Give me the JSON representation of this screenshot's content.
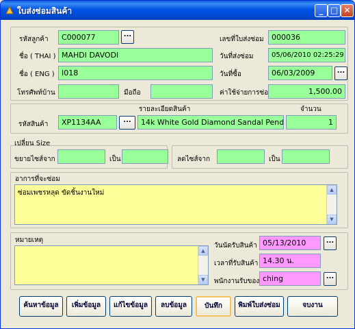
{
  "window": {
    "title": "ใบส่งซ่อมสินค้า"
  },
  "customer": {
    "code_label": "รหัสลูกค้า",
    "code_value": "C000077",
    "name_th_label": "ชื่อ ( THAI )",
    "name_th_value": "MAHDI DAVODI",
    "name_en_label": "ชื่อ ( ENG )",
    "name_en_value": "I018",
    "home_phone_label": "โทรศัพท์บ้าน",
    "home_phone_value": "",
    "mobile_label": "มือถือ",
    "mobile_value": ""
  },
  "repair": {
    "doc_no_label": "เลขที่ใบส่งซ่อม",
    "doc_no_value": "000036",
    "send_date_label": "วันที่ส่งซ่อม",
    "send_date_value": "05/06/2010 02:25:29",
    "purchase_date_label": "วันที่ซื้อ",
    "purchase_date_value": "06/03/2009",
    "cost_label": "ค่าใช้จ่ายการซ่อม",
    "cost_value": "1,500.00"
  },
  "product": {
    "detail_header": "รายละเอียดสินค้า",
    "qty_header": "จำนวน",
    "code_label": "รหัสสินค้า",
    "code_value": "XP1134AA",
    "detail_value": "14k White Gold Diamond Sandal Pendar",
    "qty_value": "1"
  },
  "size": {
    "title": "เปลี่ยน Size",
    "expand_from_label": "ขยายไซส์จาก",
    "expand_from_value": "",
    "to_label_1": "เป็น",
    "expand_to_value": "",
    "reduce_from_label": "ลดไซส์จาก",
    "reduce_from_value": "",
    "to_label_2": "เป็น",
    "reduce_to_value": ""
  },
  "symptom": {
    "label": "อาการที่จะซ่อม",
    "value": "ซ่อมเพชรหลุด ขัดชิ้นงานใหม่"
  },
  "note": {
    "label": "หมายเหตุ",
    "value": ""
  },
  "pickup": {
    "date_label": "วันนัดรับสินค้า",
    "date_value": "05/13/2010",
    "time_label": "เวลาที่รับสินค้า",
    "time_value": "14.30 น.",
    "staff_label": "พนักงานรับของ",
    "staff_value": "ching"
  },
  "ellipsis": "...",
  "buttons": {
    "search": "ค้นหาข้อมูล",
    "add": "เพิ่มข้อมูล",
    "edit": "แก้ไขข้อมูล",
    "delete": "ลบข้อมูล",
    "save": "บันทึก",
    "print": "พิมพ์ใบส่งซ่อม",
    "close": "จบงาน"
  }
}
